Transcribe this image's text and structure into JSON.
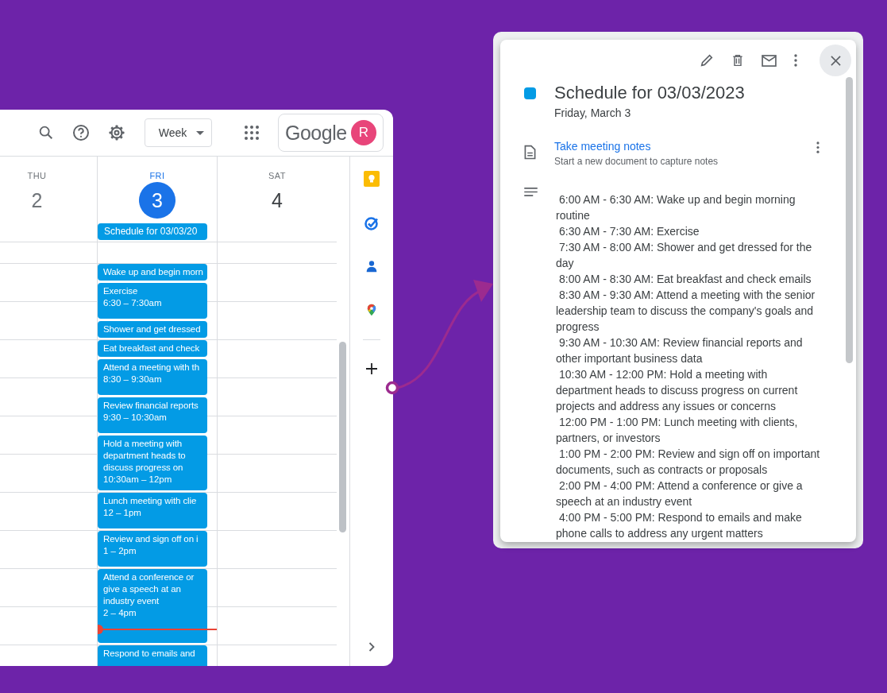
{
  "toolbar": {
    "view_select": "Week",
    "logo": "Google",
    "avatar": "R"
  },
  "days": [
    {
      "name": "THU",
      "number": "2",
      "selected": false
    },
    {
      "name": "FRI",
      "number": "3",
      "selected": true
    },
    {
      "name": "SAT",
      "number": "4",
      "selected": false
    }
  ],
  "all_day_event": "Schedule for 03/03/20",
  "events": [
    {
      "kind": "half",
      "title": "Wake up and begin morn"
    },
    {
      "kind": "hour",
      "title": "Exercise",
      "time": "6:30 – 7:30am"
    },
    {
      "kind": "half",
      "title": "Shower and get dressed"
    },
    {
      "kind": "half",
      "title": "Eat breakfast and check"
    },
    {
      "kind": "hour",
      "title": "Attend a meeting with th",
      "time": "8:30 – 9:30am"
    },
    {
      "kind": "hour",
      "title": "Review financial reports",
      "time": "9:30 – 10:30am"
    },
    {
      "kind": "ninety",
      "title": "Hold a meeting with department heads to discuss progress on",
      "time": "10:30am – 12pm"
    },
    {
      "kind": "hour",
      "title": "Lunch meeting with clie",
      "time": "12 – 1pm"
    },
    {
      "kind": "hour",
      "title": "Review and sign off on i",
      "time": "1 – 2pm"
    },
    {
      "kind": "two_hours",
      "title": "Attend a conference or give a speech at an industry event",
      "time": "2 – 4pm"
    },
    {
      "kind": "hour",
      "title": "Respond to emails and"
    }
  ],
  "popup": {
    "title": "Schedule for 03/03/2023",
    "date": "Friday, March 3",
    "attachment": {
      "title": "Take meeting notes",
      "subtitle": "Start a new document to capture notes"
    },
    "description": [
      "6:00 AM - 6:30 AM: Wake up and begin morning routine",
      "6:30 AM - 7:30 AM: Exercise",
      "7:30 AM - 8:00 AM: Shower and get dressed for the day",
      "8:00 AM - 8:30 AM: Eat breakfast and check emails",
      "8:30 AM - 9:30 AM: Attend a meeting with the senior leadership team to discuss the company's goals and progress",
      "9:30 AM - 10:30 AM: Review financial reports and other important business data",
      "10:30 AM - 12:00 PM: Hold a meeting with department heads to discuss progress on current projects and address any issues or concerns",
      "12:00 PM - 1:00 PM: Lunch meeting with clients, partners, or investors",
      "1:00 PM - 2:00 PM: Review and sign off on important documents, such as contracts or proposals",
      "2:00 PM - 4:00 PM: Attend a conference or give a speech at an industry event",
      "4:00 PM - 5:00 PM: Respond to emails and make phone calls to address any urgent matters"
    ]
  }
}
